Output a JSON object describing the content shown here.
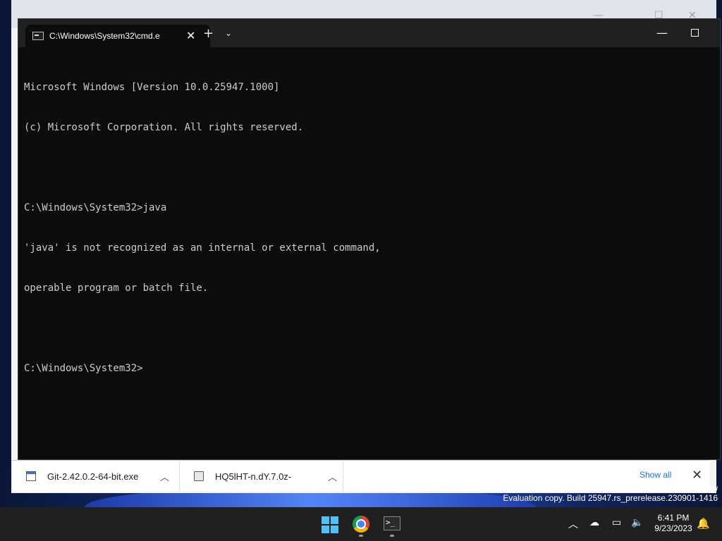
{
  "terminal": {
    "tab_title": "C:\\Windows\\System32\\cmd.e",
    "lines": [
      "Microsoft Windows [Version 10.0.25947.1000]",
      "(c) Microsoft Corporation. All rights reserved.",
      "",
      "C:\\Windows\\System32>java",
      "'java' is not recognized as an internal or external command,",
      "operable program or batch file.",
      "",
      "C:\\Windows\\System32>"
    ]
  },
  "downloads": {
    "items": [
      {
        "name": "Git-2.42.0.2-64-bit.exe",
        "icon": "exe-file-icon"
      },
      {
        "name": "HQ5lHT-n.dY.7.0z-",
        "icon": "document-file-icon"
      }
    ],
    "show_all_label": "Show all"
  },
  "desktop": {
    "evaluation_text": "Evaluation copy. Build 25947.rs_prerelease.230901-1416",
    "partial_text": "ew"
  },
  "taskbar": {
    "time": "6:41 PM",
    "date": "9/23/2023",
    "apps": [
      "start-icon",
      "chrome-icon",
      "terminal-icon"
    ]
  }
}
